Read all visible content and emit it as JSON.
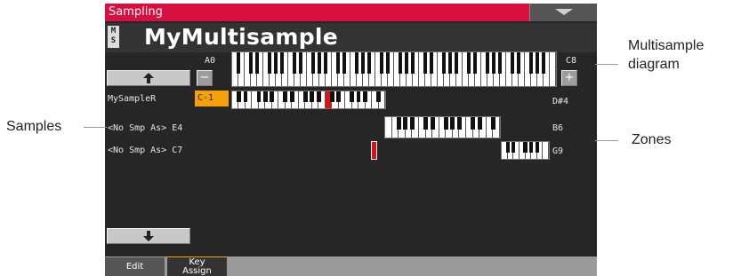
{
  "header": {
    "title": "Sampling",
    "menu_icon": "triangle-down-icon"
  },
  "multisample": {
    "badge": "M\nS",
    "name": "MyMultisample"
  },
  "diagram": {
    "range_low": "A0",
    "range_high": "C8",
    "minus_label": "−",
    "plus_label": "+"
  },
  "rows": [
    {
      "sample": "MySampleR",
      "root": "C-1",
      "top": "D#4"
    },
    {
      "sample": "<No Smp As> E4",
      "top": "B6"
    },
    {
      "sample": "<No Smp As> C7",
      "top": "G9"
    }
  ],
  "scroll": {
    "up_icon": "arrow-up-icon",
    "down_icon": "arrow-down-icon"
  },
  "tabs": [
    {
      "label": "Edit",
      "active": false
    },
    {
      "label": "Key\nAssign",
      "active": true
    }
  ],
  "callouts": {
    "multisample_diagram": "Multisample\ndiagram",
    "samples": "Samples",
    "zones": "Zones"
  },
  "colors": {
    "title_bar": "#d90f3f",
    "accent_orange": "#f5a20a",
    "marker_red": "#e01010",
    "screen_bg": "#262626"
  }
}
